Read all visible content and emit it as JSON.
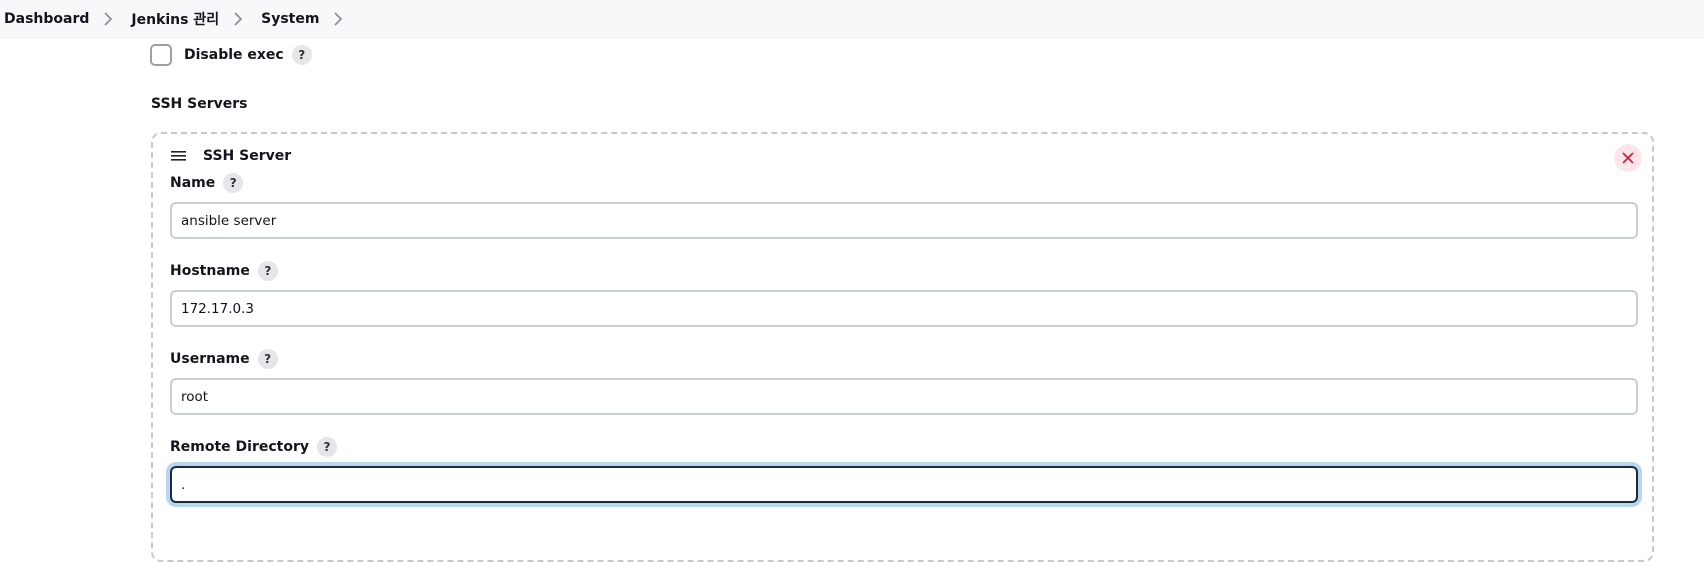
{
  "breadcrumb": {
    "items": [
      "Dashboard",
      "Jenkins 관리",
      "System"
    ]
  },
  "disable_exec": {
    "label": "Disable exec",
    "checked": false,
    "help": "?"
  },
  "ssh_servers": {
    "section_title": "SSH Servers",
    "server": {
      "title": "SSH Server",
      "fields": {
        "name": {
          "label": "Name",
          "value": "ansible server",
          "help": "?"
        },
        "hostname": {
          "label": "Hostname",
          "value": "172.17.0.3",
          "help": "?"
        },
        "username": {
          "label": "Username",
          "value": "root",
          "help": "?"
        },
        "remote_directory": {
          "label": "Remote Directory",
          "value": ".",
          "help": "?"
        }
      }
    }
  },
  "colors": {
    "close_icon": "#d5203b",
    "close_bg": "#fde6ea",
    "focus_ring": "#b8d6ee"
  }
}
